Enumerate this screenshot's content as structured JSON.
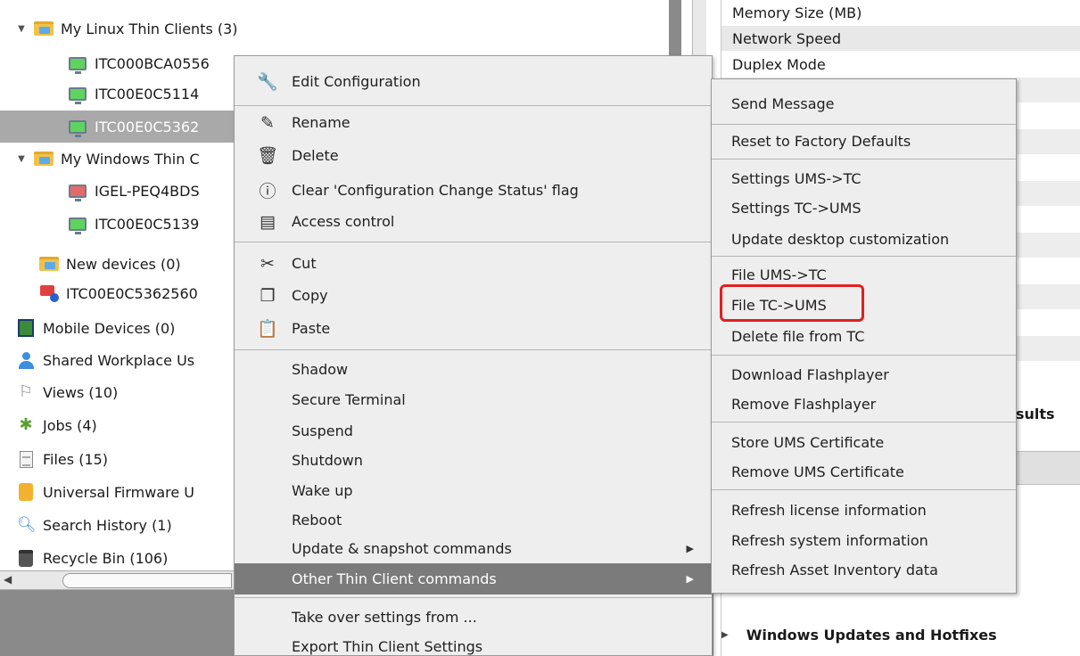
{
  "tree": {
    "items": [
      {
        "label": "My Linux Thin Clients (3)",
        "icon": "folder-icon",
        "expander": "▼"
      },
      {
        "label": "ITC000BCA0556",
        "icon": "thin-client-online-icon"
      },
      {
        "label": "ITC00E0C5114",
        "icon": "thin-client-online-icon"
      },
      {
        "label": "ITC00E0C5362",
        "icon": "thin-client-online-icon"
      },
      {
        "label": "My Windows Thin C",
        "icon": "folder-icon",
        "expander": "▼"
      },
      {
        "label": "IGEL-PEQ4BDS",
        "icon": "thin-client-offline-icon"
      },
      {
        "label": "ITC00E0C5139",
        "icon": "thin-client-online-icon"
      },
      {
        "label": "New devices (0)",
        "icon": "folder-icon"
      },
      {
        "label": "ITC00E0C5362560",
        "icon": "unregistered-device-icon"
      },
      {
        "label": "Mobile Devices (0)",
        "icon": "mobile-devices-icon"
      },
      {
        "label": "Shared Workplace Us",
        "icon": "user-icon"
      },
      {
        "label": "Views (10)",
        "icon": "views-icon"
      },
      {
        "label": "Jobs (4)",
        "icon": "jobs-icon"
      },
      {
        "label": "Files (15)",
        "icon": "file-icon"
      },
      {
        "label": "Universal Firmware U",
        "icon": "firmware-icon"
      },
      {
        "label": "Search History (1)",
        "icon": "search-icon"
      },
      {
        "label": "Recycle Bin (106)",
        "icon": "recycle-bin-icon"
      }
    ]
  },
  "properties": {
    "rows": [
      "Memory Size (MB)",
      "Network Speed",
      "Duplex Mode"
    ],
    "results_label": "sults",
    "windows_updates": "Windows Updates and Hotfixes"
  },
  "context_menu": {
    "items": [
      {
        "label": "Edit Configuration",
        "icon": "wrench-icon",
        "glyph": "🔧"
      },
      {
        "label": "Rename",
        "icon": "pencil-icon",
        "glyph": "✎"
      },
      {
        "label": "Delete",
        "icon": "trash-icon",
        "glyph": "🗑"
      },
      {
        "label": "Clear 'Configuration Change Status' flag",
        "icon": "exclamation-circle-icon",
        "glyph": "ⓘ"
      },
      {
        "label": "Access control",
        "icon": "access-control-icon",
        "glyph": "▤"
      },
      {
        "label": "Cut",
        "icon": "scissors-icon",
        "glyph": "✂"
      },
      {
        "label": "Copy",
        "icon": "copy-icon",
        "glyph": "❐"
      },
      {
        "label": "Paste",
        "icon": "clipboard-icon",
        "glyph": "📋"
      },
      {
        "label": "Shadow"
      },
      {
        "label": "Secure Terminal"
      },
      {
        "label": "Suspend"
      },
      {
        "label": "Shutdown"
      },
      {
        "label": "Wake up"
      },
      {
        "label": "Reboot"
      },
      {
        "label": "Update & snapshot commands",
        "submenu": true
      },
      {
        "label": "Other Thin Client commands",
        "submenu": true,
        "highlighted": true
      },
      {
        "label": "Take over settings from ..."
      },
      {
        "label": "Export Thin Client Settings"
      }
    ],
    "highlight_color": "#7b7b7b"
  },
  "submenu": {
    "items": [
      "Send Message",
      "Reset to Factory Defaults",
      "Settings UMS->TC",
      "Settings TC->UMS",
      "Update desktop customization",
      "File UMS->TC",
      "File TC->UMS",
      "Delete file from TC",
      "Download Flashplayer",
      "Remove Flashplayer",
      "Store UMS Certificate",
      "Remove UMS Certificate",
      "Refresh license information",
      "Refresh system information",
      "Refresh Asset Inventory data"
    ],
    "annotation_color": "#e02020"
  },
  "glyphs": {
    "submenu_arrow": "▶",
    "expander": "▼",
    "scroll_left": "◀",
    "collapsed": "▶"
  }
}
